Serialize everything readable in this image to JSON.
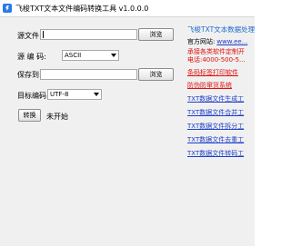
{
  "window": {
    "title": "飞梭TXT文本文件编码转换工具 v1.0.0.0"
  },
  "form": {
    "source_file_label": "源文件:",
    "browse_label": "浏览",
    "source_encoding_label": "源 编 码:",
    "source_encoding_value": "ASCII",
    "save_to_label": "保存到:",
    "browse2_label": "浏览",
    "target_encoding_label": "目标编码:",
    "target_encoding_value": "UTF-8",
    "convert_label": "转换",
    "status_text": "未开始"
  },
  "side": {
    "header": "飞梭TXT文本数据处理器",
    "website_prefix": "官方网站:",
    "website_url": "www.ee...",
    "promo_line1": "承接各类软件定制开",
    "promo_line2": "电话:4000-500-5...",
    "links": [
      "条码标签打印软件",
      "防伪防窜货系统",
      "TXT数据文件生成工",
      "TXT数据文件合并工",
      "TXT数据文件拆分工",
      "TXT数据文件去重工",
      "TXT数据文件转码工"
    ]
  },
  "colors": {
    "link": "#1c3ec9",
    "accent": "#1c6bd0",
    "promo": "#e01010",
    "client_bg": "#f0f0f0"
  }
}
